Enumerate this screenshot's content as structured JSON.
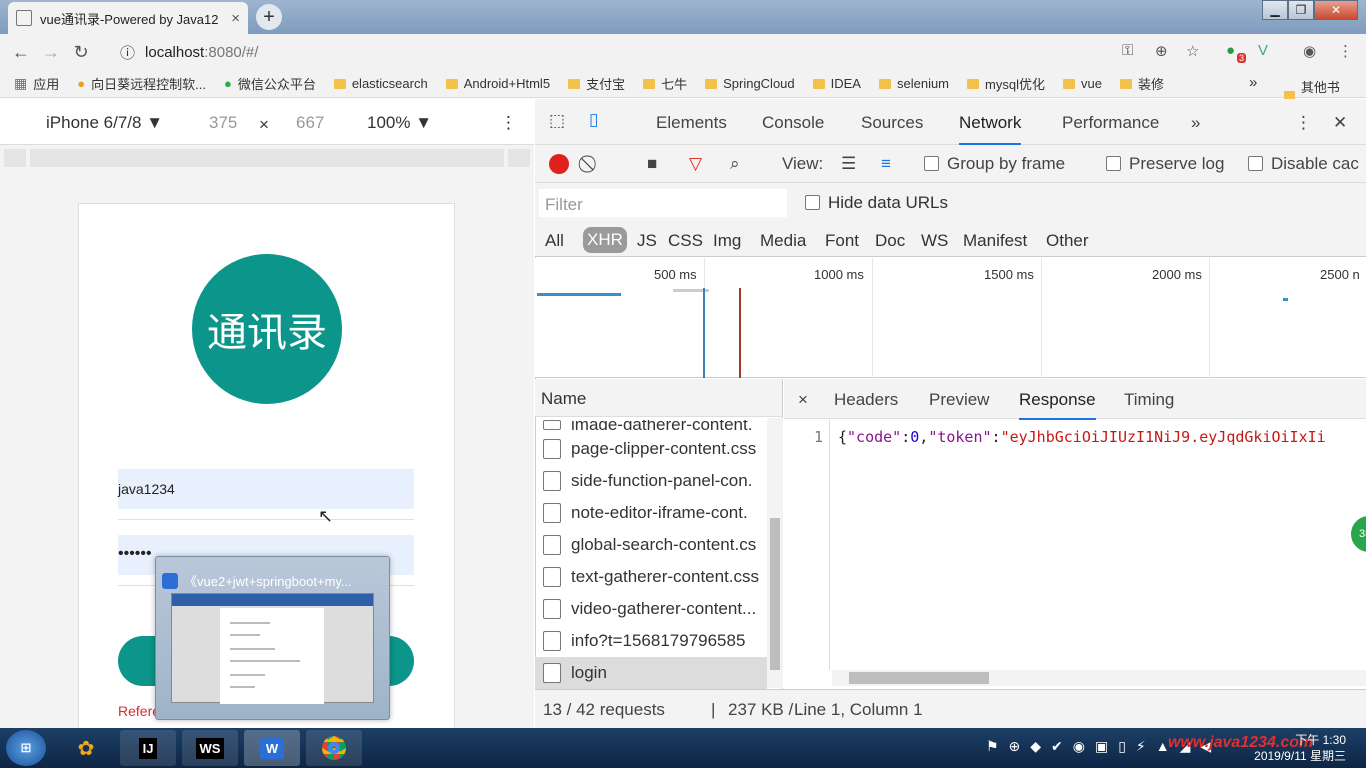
{
  "browser": {
    "tab_title": "vue通讯录-Powered by Java12",
    "tab_close": "×",
    "new_tab": "+",
    "url_host": "localhost",
    "url_path": ":8080/#/",
    "bookmarks": [
      "应用",
      "向日葵远程控制软...",
      "微信公众平台",
      "elasticsearch",
      "Android+Html5",
      "支付宝",
      "七牛",
      "SpringCloud",
      "IDEA",
      "selenium",
      "mysql优化",
      "vue",
      "装修"
    ],
    "bookmarks_more": "»",
    "other_bookmarks": "其他书签",
    "ext_badge": "3"
  },
  "device_toolbar": {
    "device": "iPhone 6/7/8 ▼",
    "width": "375",
    "x": "×",
    "height": "667",
    "zoom": "100% ▼"
  },
  "app": {
    "logo_text": "通讯录",
    "username_value": "java1234",
    "password_value": "••••••",
    "error_text": "ReferenceError: token is not defined"
  },
  "taskbar_preview": {
    "title": "《vue2+jwt+springboot+my..."
  },
  "devtools": {
    "tabs": [
      "Elements",
      "Console",
      "Sources",
      "Network",
      "Performance",
      "»"
    ],
    "active_tab": "Network",
    "toolbar": {
      "view_label": "View:",
      "group_by_frame": "Group by frame",
      "preserve_log": "Preserve log",
      "disable_cache": "Disable cac"
    },
    "filter_placeholder": "Filter",
    "hide_data_urls": "Hide data URLs",
    "types": [
      "All",
      "XHR",
      "JS",
      "CSS",
      "Img",
      "Media",
      "Font",
      "Doc",
      "WS",
      "Manifest",
      "Other"
    ],
    "active_type": "XHR",
    "timeline_labels": [
      "500 ms",
      "1000 ms",
      "1500 ms",
      "2000 ms",
      "2500 n"
    ],
    "name_header": "Name",
    "requests": [
      "image-gatherer-content.",
      "page-clipper-content.css",
      "side-function-panel-con.",
      "note-editor-iframe-cont.",
      "global-search-content.cs",
      "text-gatherer-content.css",
      "video-gatherer-content...",
      "info?t=1568179796585",
      "login"
    ],
    "selected_request": "login",
    "detail_tabs": [
      "×",
      "Headers",
      "Preview",
      "Response",
      "Timing"
    ],
    "active_detail_tab": "Response",
    "line_number": "1",
    "response_body": "{\"code\":0,\"token\":\"eyJhbGciOiJIUzI1NiJ9.eyJqdGkiOiIxIi",
    "status_left": "13 / 42 requests",
    "status_sep": "|",
    "status_size": "237 KB / ...",
    "status_right": "Line 1, Column 1"
  },
  "taskbar": {
    "apps": [
      "IJ",
      "WS",
      "W",
      ""
    ],
    "time": "下午 1:30",
    "date": "2019/9/11 星期三",
    "watermark": "www.java1234.com"
  },
  "colors": {
    "accent": "#0c958a",
    "record": "#e0201c",
    "link": "#1a73e8"
  }
}
